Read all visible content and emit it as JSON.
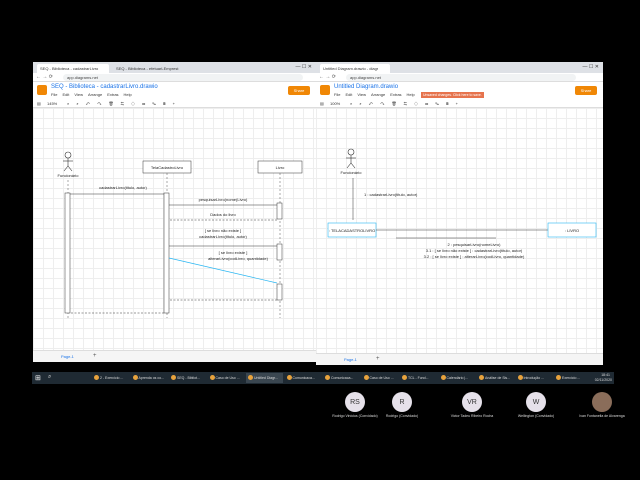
{
  "left_window": {
    "tabs": [
      "SEQ - Biblioteca - cadastrarLivro",
      "SEQ - Biblioteca - efetuarLEmprest"
    ],
    "url": "app.diagrams.net",
    "filename": "SEQ - Biblioteca - cadastrarLivro.drawio",
    "menu": [
      "File",
      "Edit",
      "View",
      "Arrange",
      "Extras",
      "Help"
    ],
    "share_label": "Share",
    "zoom": "145%",
    "page_tab": "Page-1",
    "diagram": {
      "actor": "Funcionário",
      "lifeline1": "TelaCadastroLivro",
      "lifeline2": "Livro",
      "msg1": "cadastrarLivro(titulo, autor)",
      "msg2": "pesquisarLivro(nome(Livro)",
      "msg3": "Dados do livro",
      "msg4a": "[ se livro não existe ]",
      "msg4b": "cadastrarLivro(titulo, autor)",
      "msg5a": "[ se livro existe ]",
      "msg5b": "alterarLivro(codLivro, quantidade)"
    }
  },
  "right_window": {
    "tabs": [
      "Untitled Diagram.drawio - diagr"
    ],
    "url": "app.diagrams.net",
    "filename": "Untitled Diagram.drawio",
    "menu": [
      "File",
      "Edit",
      "View",
      "Arrange",
      "Extras",
      "Help"
    ],
    "unsaved": "Unsaved changes. Click here to save.",
    "share_label": "Share",
    "zoom": "100%",
    "page_tab": "Page-1",
    "diagram": {
      "actor": "Funcionário",
      "obj1": ": TELACADASTROLIVRO",
      "obj2": ": LIVRO",
      "msg1": "1 : cadastrarLivro(titulo, autor)",
      "msg2": "2 : pesquisarLivro(nomeLivro)",
      "msg3": "3.1 : [ se livro não existe ] : cadastrarLivro(titulo, autor)",
      "msg4": "3.2 : [ se livro existe ] : alterarLivro(codLivro, quantidade)"
    }
  },
  "taskbar": {
    "items": [
      "2 - Exercício ...",
      "Aprenda os co...",
      "SEQ - Bibliot...",
      "Caso de Uso ...",
      "Untitled Diagr...",
      "Comunicaca...",
      "Comunicaca...",
      "Caso de Uso ...",
      "TCL - Fund...",
      "Calendário |...",
      "Análise de Sis...",
      "Introdução ...",
      "Exercício ..."
    ],
    "time": "18:41",
    "date": "02/11/2020"
  },
  "participants": [
    {
      "initials": "RS",
      "name": "Rodrigo Vinícius (Convidado)"
    },
    {
      "initials": "R",
      "name": "Rodrigo (Convidado)"
    },
    {
      "initials": "VR",
      "name": "Victor Tadeu Ribeiro Rocha"
    },
    {
      "initials": "W",
      "name": "Wellington (Convidado)"
    },
    {
      "initials": "",
      "name": "Ivan Fontanella de Alvarenga"
    }
  ]
}
